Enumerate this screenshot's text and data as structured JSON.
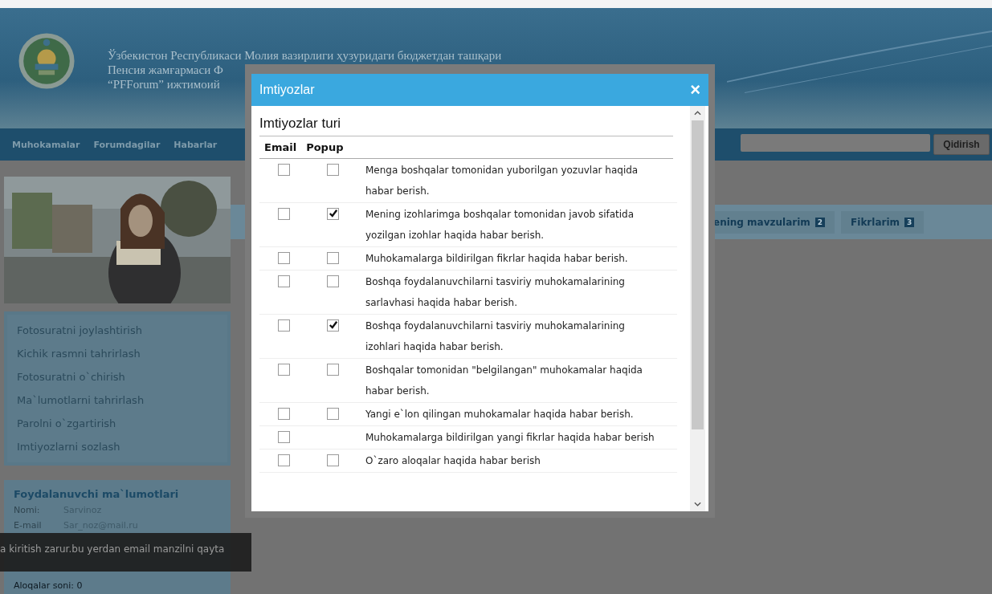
{
  "header": {
    "title_lines": [
      "Ўзбекистон Республикаси Молия вазирлиги ҳузуридаги бюджетдан ташқари",
      "Пенсия жамғармаси Ф",
      "“PFForum” ижтимоий"
    ]
  },
  "nav": {
    "items": [
      "Muhokamalar",
      "Forumdagilar",
      "Habarlar"
    ],
    "search_button": "Qidirish"
  },
  "profile_menu": [
    "Fotosuratni joylashtirish",
    "Kichik rasmni tahrirlash",
    "Fotosuratni o`chirish",
    "Ma`lumotlarni tahrirlash",
    "Parolni o`zgartirish",
    "Imtiyozlarni sozlash"
  ],
  "user_info": {
    "title": "Foydalanuvchi ma`lumotlari",
    "fields": [
      {
        "label": "Nomi:",
        "value": "Sarvinoz"
      },
      {
        "label": "E-mail",
        "value": "Sar_noz@mail.ru"
      }
    ],
    "footer": "Aloqalar soni: 0"
  },
  "tabs": [
    {
      "label": "ening mavzularim",
      "count": "2"
    },
    {
      "label": "Fikrlarim",
      "count": "3"
    }
  ],
  "toast": "a kiritish zarur.bu yerdan email manzilni qayta",
  "dialog": {
    "title": "Imtiyozlar",
    "close": "×",
    "section": "Imtiyozlar turi",
    "columns": [
      "Email",
      "Popup"
    ],
    "rows": [
      {
        "text": "Menga boshqalar tomonidan yuborilgan yozuvlar haqida habar berish.",
        "email": false,
        "popup": false
      },
      {
        "text": "Mening izohlarimga boshqalar tomonidan javob sifatida yozilgan izohlar haqida habar berish.",
        "email": false,
        "popup": true
      },
      {
        "text": "Muhokamalarga bildirilgan fikrlar haqida habar berish.",
        "email": false,
        "popup": false
      },
      {
        "text": "Boshqa foydalanuvchilarni tasviriy muhokamalarining sarlavhasi haqida habar berish.",
        "email": false,
        "popup": false
      },
      {
        "text": "Boshqa foydalanuvchilarni tasviriy muhokamalarining izohlari haqida habar berish.",
        "email": false,
        "popup": true
      },
      {
        "text": "Boshqalar tomonidan \"belgilangan\" muhokamalar haqida habar berish.",
        "email": false,
        "popup": false
      },
      {
        "text": "Yangi e`lon qilingan muhokamalar haqida habar berish.",
        "email": false,
        "popup": false
      },
      {
        "text": "Muhokamalarga bildirilgan yangi fikrlar haqida habar berish",
        "email": false
      },
      {
        "text": "O`zaro aloqalar haqida habar berish",
        "email": false,
        "popup": false
      }
    ]
  }
}
